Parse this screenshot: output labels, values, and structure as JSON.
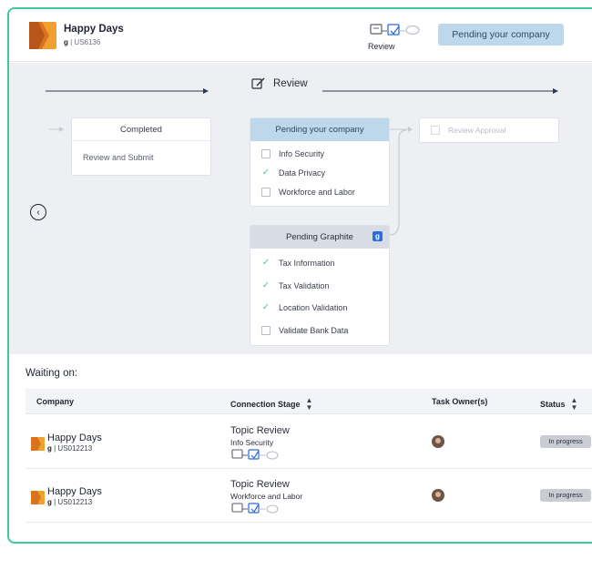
{
  "header": {
    "company_name": "Happy Days",
    "company_code": "g",
    "company_id": "US6136",
    "stage_caption": "Review",
    "status_label": "Pending your company"
  },
  "flow": {
    "review_title": "Review",
    "completed": {
      "title": "Completed",
      "items": [
        "Review and Submit"
      ]
    },
    "pending_company": {
      "title": "Pending your company",
      "items": [
        {
          "label": "Info Security",
          "done": false
        },
        {
          "label": "Data Privacy",
          "done": true
        },
        {
          "label": "Workforce and Labor",
          "done": false
        }
      ]
    },
    "pending_graphite": {
      "title": "Pending Graphite",
      "badge": "g",
      "items": [
        {
          "label": "Tax Information",
          "done": true
        },
        {
          "label": "Tax Validation",
          "done": true
        },
        {
          "label": "Location Validation",
          "done": true
        },
        {
          "label": "Validate Bank Data",
          "done": false
        }
      ]
    },
    "review_approval": {
      "label": "Review Approval"
    }
  },
  "waiting": {
    "title": "Waiting on:",
    "columns": {
      "company": "Company",
      "stage": "Connection Stage",
      "owner": "Task Owner(s)",
      "status": "Status"
    },
    "rows": [
      {
        "company": "Happy Days",
        "code": "g",
        "id": "US012213",
        "stage": "Topic Review",
        "sub": "Info Security",
        "status": "In progress"
      },
      {
        "company": "Happy Days",
        "code": "g",
        "id": "US012213",
        "stage": "Topic Review",
        "sub": "Workforce and Labor",
        "status": "In progress"
      }
    ]
  },
  "colors": {
    "accent": "#3ec99a",
    "pending": "#bcd8ea",
    "brand_blue": "#2d6be0",
    "logo_orange": "#f0a030"
  }
}
